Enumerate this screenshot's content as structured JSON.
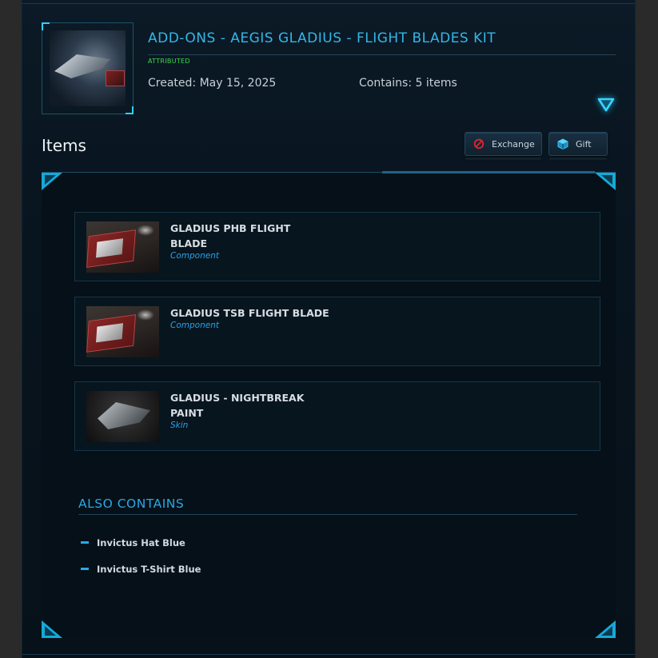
{
  "package": {
    "title": "ADD-ONS - AEGIS GLADIUS - FLIGHT BLADES KIT",
    "status_tag": "ATTRIBUTED",
    "created": "Created: May 15, 2025",
    "contains": "Contains: 5 items",
    "thumbnail_icon": "ship-thumbnail"
  },
  "items_section": {
    "heading": "Items",
    "actions": [
      {
        "label": "Exchange",
        "icon": "exchange-icon",
        "icon_color": "#e0242b"
      },
      {
        "label": "Gift",
        "icon": "gift-icon",
        "icon_color": "#3fc3ee"
      }
    ]
  },
  "items": [
    {
      "name": "GLADIUS PHB FLIGHT BLADE",
      "kind": "Component",
      "image": "flight-blade-crate"
    },
    {
      "name": "GLADIUS TSB FLIGHT BLADE",
      "kind": "Component",
      "image": "flight-blade-crate"
    },
    {
      "name": "GLADIUS - NIGHTBREAK PAINT",
      "kind": "Skin",
      "image": "ship-skin"
    }
  ],
  "also_contains": {
    "heading": "ALSO CONTAINS",
    "items": [
      "Invictus Hat Blue",
      "Invictus T-Shirt Blue"
    ]
  },
  "colors": {
    "accent": "#2aa8e2",
    "attributed": "#3ddc4a",
    "background": "#08141e"
  }
}
